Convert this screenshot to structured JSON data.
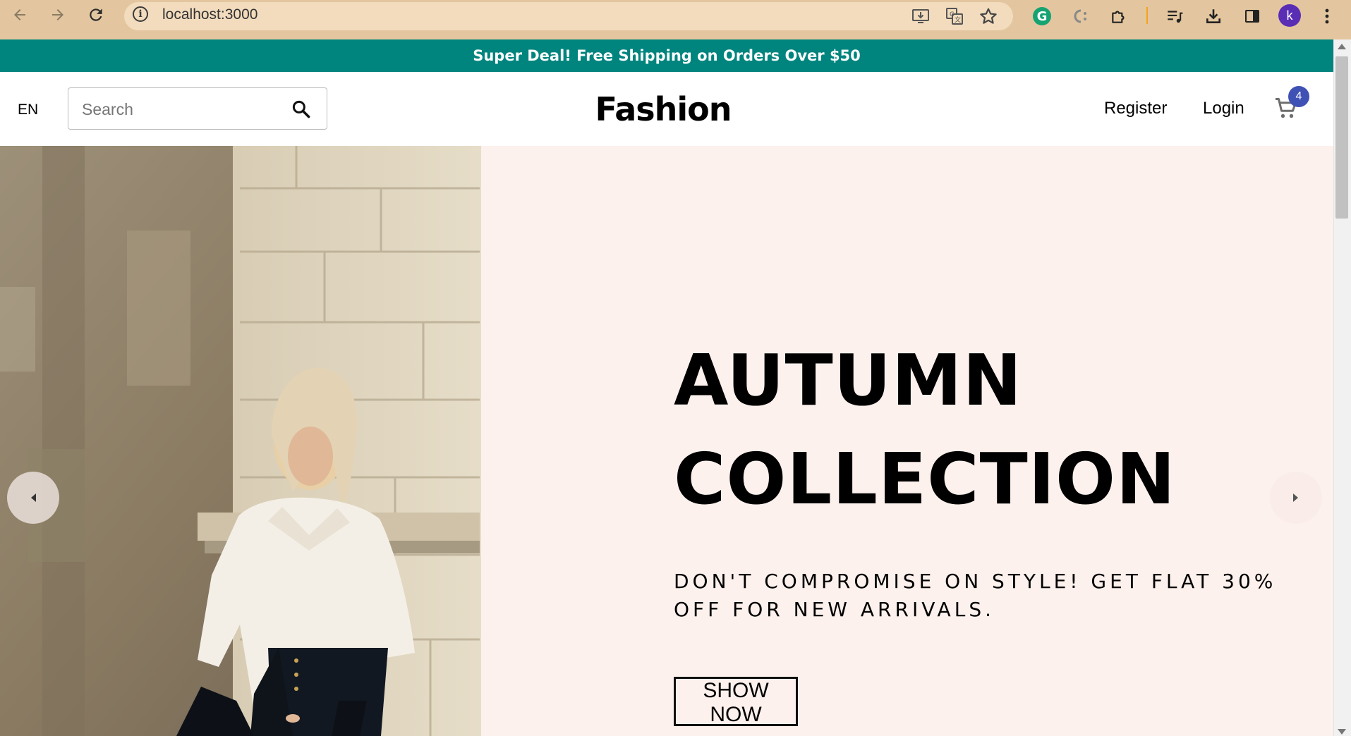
{
  "browser": {
    "url": "localhost:3000",
    "avatar_letter": "k",
    "theme_color": "#e3c69f"
  },
  "announcement": {
    "text": "Super Deal! Free Shipping on Orders Over $50",
    "background": "#00847e"
  },
  "navbar": {
    "language": "EN",
    "search_placeholder": "Search",
    "search_value": "",
    "logo": "Fashion",
    "register_label": "Register",
    "login_label": "Login",
    "cart_count": "4",
    "cart_badge_color": "#3f51b5"
  },
  "hero": {
    "title_line1": "AUTUMN",
    "title_line2": "COLLECTION",
    "desc_line1": "DON'T COMPROMISE ON STYLE! GET FLAT 30%",
    "desc_line2": "OFF FOR NEW ARRIVALS.",
    "button_label": "SHOW NOW",
    "background": "#fcf1ed",
    "image_subject": "model in white sweater and black skirt leaning on stone wall"
  },
  "icons": {
    "back": "arrow-left-icon",
    "forward": "arrow-right-icon",
    "reload": "reload-icon",
    "info": "info-icon",
    "install": "install-app-icon",
    "translate": "translate-icon",
    "bookmark": "star-icon",
    "grammarly": "grammarly-icon",
    "extension_c": "extension-icon",
    "extensions": "puzzle-icon",
    "media": "media-control-icon",
    "download": "download-icon",
    "side_panel": "side-panel-icon",
    "menu": "more-vert-icon",
    "search": "search-icon",
    "cart": "cart-icon",
    "slider_prev": "chevron-left-icon",
    "slider_next": "chevron-right-icon"
  }
}
